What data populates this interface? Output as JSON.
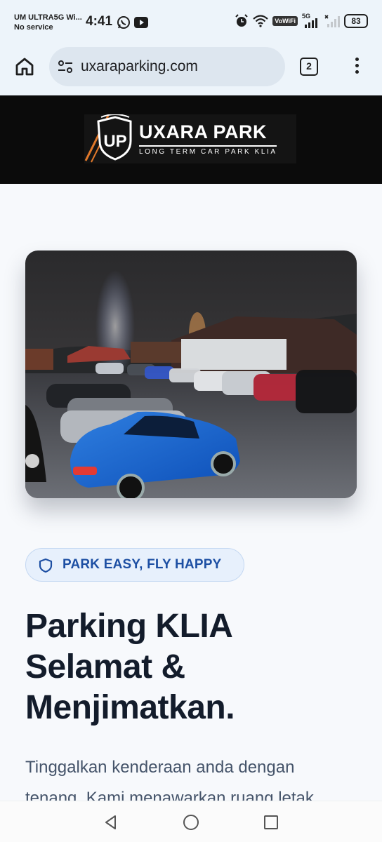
{
  "status_bar": {
    "carrier_line1": "UM ULTRA5G Wi...",
    "carrier_line2": "No service",
    "time": "4:41",
    "network_type": "5G",
    "vowifi_label": "VoWiFi",
    "battery": "83"
  },
  "browser": {
    "url": "uxaraparking.com",
    "tab_count": "2"
  },
  "site_header": {
    "logo_mark": "UP",
    "logo_title": "UXARA PARK",
    "logo_subtitle": "LONG TERM CAR PARK KLIA"
  },
  "hero": {
    "badge_text": "PARK EASY, FLY HAPPY",
    "headline_line1": "Parking KLIA",
    "headline_line2": "Selamat &",
    "headline_line3": "Menjimatkan.",
    "body_line1": "Tinggalkan kenderaan anda dengan",
    "body_line2": "tenang. Kami menawarkan ruang letak"
  },
  "colors": {
    "accent": "#1d4fa3",
    "header_bg": "#0b0b0b",
    "logo_orange": "#e0782a"
  },
  "icons": [
    "whatsapp-icon",
    "youtube-icon",
    "alarm-icon",
    "wifi-icon",
    "signal-icon",
    "home-icon",
    "site-info-icon",
    "more-vert-icon",
    "shield-icon",
    "back-icon",
    "home-circle-icon",
    "recents-icon"
  ]
}
